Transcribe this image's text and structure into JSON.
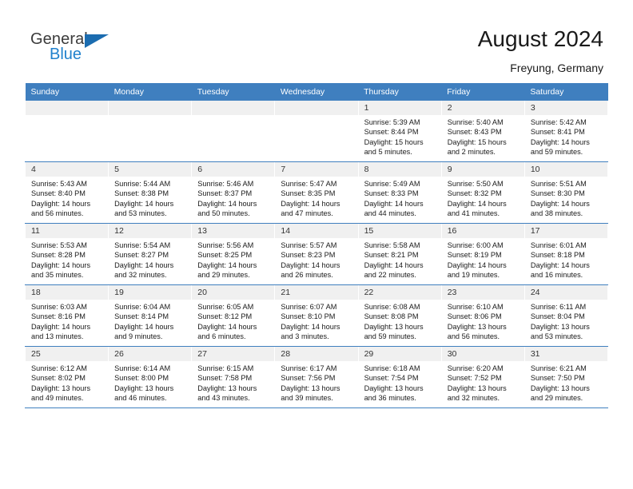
{
  "brand": {
    "name_part1": "General",
    "name_part2": "Blue",
    "color_dark": "#3b3b3b",
    "color_blue": "#2081cd",
    "triangle_color": "#1b6cb0"
  },
  "header": {
    "title": "August 2024",
    "subtitle": "Freyung, Germany",
    "accent_color": "#3f7fbf",
    "daynum_band_color": "#f0f0f0"
  },
  "weekday_headers": [
    "Sunday",
    "Monday",
    "Tuesday",
    "Wednesday",
    "Thursday",
    "Friday",
    "Saturday"
  ],
  "labels": {
    "sunrise": "Sunrise:",
    "sunset": "Sunset:",
    "daylight": "Daylight:"
  },
  "weeks": [
    [
      {
        "day": "",
        "empty": true
      },
      {
        "day": "",
        "empty": true
      },
      {
        "day": "",
        "empty": true
      },
      {
        "day": "",
        "empty": true
      },
      {
        "day": "1",
        "sunrise": "Sunrise: 5:39 AM",
        "sunset": "Sunset: 8:44 PM",
        "daylight1": "Daylight: 15 hours",
        "daylight2": "and 5 minutes."
      },
      {
        "day": "2",
        "sunrise": "Sunrise: 5:40 AM",
        "sunset": "Sunset: 8:43 PM",
        "daylight1": "Daylight: 15 hours",
        "daylight2": "and 2 minutes."
      },
      {
        "day": "3",
        "sunrise": "Sunrise: 5:42 AM",
        "sunset": "Sunset: 8:41 PM",
        "daylight1": "Daylight: 14 hours",
        "daylight2": "and 59 minutes."
      }
    ],
    [
      {
        "day": "4",
        "sunrise": "Sunrise: 5:43 AM",
        "sunset": "Sunset: 8:40 PM",
        "daylight1": "Daylight: 14 hours",
        "daylight2": "and 56 minutes."
      },
      {
        "day": "5",
        "sunrise": "Sunrise: 5:44 AM",
        "sunset": "Sunset: 8:38 PM",
        "daylight1": "Daylight: 14 hours",
        "daylight2": "and 53 minutes."
      },
      {
        "day": "6",
        "sunrise": "Sunrise: 5:46 AM",
        "sunset": "Sunset: 8:37 PM",
        "daylight1": "Daylight: 14 hours",
        "daylight2": "and 50 minutes."
      },
      {
        "day": "7",
        "sunrise": "Sunrise: 5:47 AM",
        "sunset": "Sunset: 8:35 PM",
        "daylight1": "Daylight: 14 hours",
        "daylight2": "and 47 minutes."
      },
      {
        "day": "8",
        "sunrise": "Sunrise: 5:49 AM",
        "sunset": "Sunset: 8:33 PM",
        "daylight1": "Daylight: 14 hours",
        "daylight2": "and 44 minutes."
      },
      {
        "day": "9",
        "sunrise": "Sunrise: 5:50 AM",
        "sunset": "Sunset: 8:32 PM",
        "daylight1": "Daylight: 14 hours",
        "daylight2": "and 41 minutes."
      },
      {
        "day": "10",
        "sunrise": "Sunrise: 5:51 AM",
        "sunset": "Sunset: 8:30 PM",
        "daylight1": "Daylight: 14 hours",
        "daylight2": "and 38 minutes."
      }
    ],
    [
      {
        "day": "11",
        "sunrise": "Sunrise: 5:53 AM",
        "sunset": "Sunset: 8:28 PM",
        "daylight1": "Daylight: 14 hours",
        "daylight2": "and 35 minutes."
      },
      {
        "day": "12",
        "sunrise": "Sunrise: 5:54 AM",
        "sunset": "Sunset: 8:27 PM",
        "daylight1": "Daylight: 14 hours",
        "daylight2": "and 32 minutes."
      },
      {
        "day": "13",
        "sunrise": "Sunrise: 5:56 AM",
        "sunset": "Sunset: 8:25 PM",
        "daylight1": "Daylight: 14 hours",
        "daylight2": "and 29 minutes."
      },
      {
        "day": "14",
        "sunrise": "Sunrise: 5:57 AM",
        "sunset": "Sunset: 8:23 PM",
        "daylight1": "Daylight: 14 hours",
        "daylight2": "and 26 minutes."
      },
      {
        "day": "15",
        "sunrise": "Sunrise: 5:58 AM",
        "sunset": "Sunset: 8:21 PM",
        "daylight1": "Daylight: 14 hours",
        "daylight2": "and 22 minutes."
      },
      {
        "day": "16",
        "sunrise": "Sunrise: 6:00 AM",
        "sunset": "Sunset: 8:19 PM",
        "daylight1": "Daylight: 14 hours",
        "daylight2": "and 19 minutes."
      },
      {
        "day": "17",
        "sunrise": "Sunrise: 6:01 AM",
        "sunset": "Sunset: 8:18 PM",
        "daylight1": "Daylight: 14 hours",
        "daylight2": "and 16 minutes."
      }
    ],
    [
      {
        "day": "18",
        "sunrise": "Sunrise: 6:03 AM",
        "sunset": "Sunset: 8:16 PM",
        "daylight1": "Daylight: 14 hours",
        "daylight2": "and 13 minutes."
      },
      {
        "day": "19",
        "sunrise": "Sunrise: 6:04 AM",
        "sunset": "Sunset: 8:14 PM",
        "daylight1": "Daylight: 14 hours",
        "daylight2": "and 9 minutes."
      },
      {
        "day": "20",
        "sunrise": "Sunrise: 6:05 AM",
        "sunset": "Sunset: 8:12 PM",
        "daylight1": "Daylight: 14 hours",
        "daylight2": "and 6 minutes."
      },
      {
        "day": "21",
        "sunrise": "Sunrise: 6:07 AM",
        "sunset": "Sunset: 8:10 PM",
        "daylight1": "Daylight: 14 hours",
        "daylight2": "and 3 minutes."
      },
      {
        "day": "22",
        "sunrise": "Sunrise: 6:08 AM",
        "sunset": "Sunset: 8:08 PM",
        "daylight1": "Daylight: 13 hours",
        "daylight2": "and 59 minutes."
      },
      {
        "day": "23",
        "sunrise": "Sunrise: 6:10 AM",
        "sunset": "Sunset: 8:06 PM",
        "daylight1": "Daylight: 13 hours",
        "daylight2": "and 56 minutes."
      },
      {
        "day": "24",
        "sunrise": "Sunrise: 6:11 AM",
        "sunset": "Sunset: 8:04 PM",
        "daylight1": "Daylight: 13 hours",
        "daylight2": "and 53 minutes."
      }
    ],
    [
      {
        "day": "25",
        "sunrise": "Sunrise: 6:12 AM",
        "sunset": "Sunset: 8:02 PM",
        "daylight1": "Daylight: 13 hours",
        "daylight2": "and 49 minutes."
      },
      {
        "day": "26",
        "sunrise": "Sunrise: 6:14 AM",
        "sunset": "Sunset: 8:00 PM",
        "daylight1": "Daylight: 13 hours",
        "daylight2": "and 46 minutes."
      },
      {
        "day": "27",
        "sunrise": "Sunrise: 6:15 AM",
        "sunset": "Sunset: 7:58 PM",
        "daylight1": "Daylight: 13 hours",
        "daylight2": "and 43 minutes."
      },
      {
        "day": "28",
        "sunrise": "Sunrise: 6:17 AM",
        "sunset": "Sunset: 7:56 PM",
        "daylight1": "Daylight: 13 hours",
        "daylight2": "and 39 minutes."
      },
      {
        "day": "29",
        "sunrise": "Sunrise: 6:18 AM",
        "sunset": "Sunset: 7:54 PM",
        "daylight1": "Daylight: 13 hours",
        "daylight2": "and 36 minutes."
      },
      {
        "day": "30",
        "sunrise": "Sunrise: 6:20 AM",
        "sunset": "Sunset: 7:52 PM",
        "daylight1": "Daylight: 13 hours",
        "daylight2": "and 32 minutes."
      },
      {
        "day": "31",
        "sunrise": "Sunrise: 6:21 AM",
        "sunset": "Sunset: 7:50 PM",
        "daylight1": "Daylight: 13 hours",
        "daylight2": "and 29 minutes."
      }
    ]
  ]
}
